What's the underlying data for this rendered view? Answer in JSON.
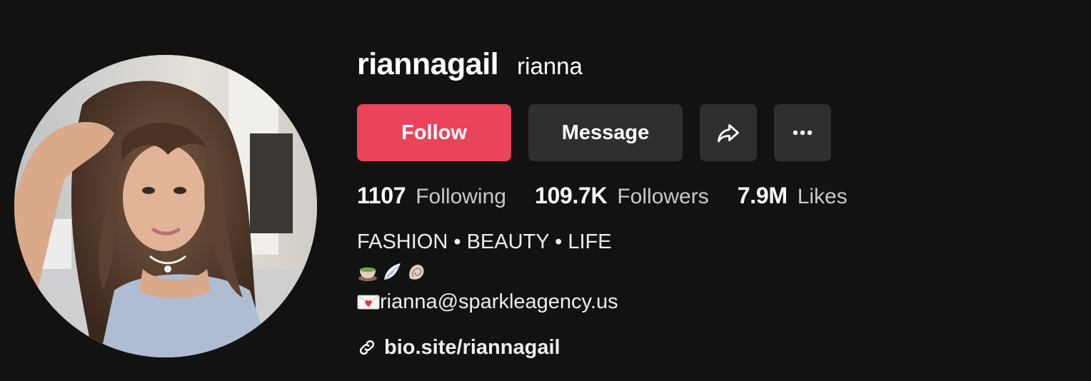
{
  "profile": {
    "username": "riannagail",
    "nickname": "rianna",
    "avatar_alt": "profile-photo"
  },
  "actions": {
    "follow_label": "Follow",
    "message_label": "Message",
    "share_icon": "share-arrow-icon",
    "more_icon": "more-dots-icon"
  },
  "stats": [
    {
      "value": "1107",
      "label": "Following"
    },
    {
      "value": "109.7K",
      "label": "Followers"
    },
    {
      "value": "7.9M",
      "label": "Likes"
    }
  ],
  "bio": {
    "line1": "FASHION • BEAUTY • LIFE",
    "emojis": [
      "matcha-bowl-emoji",
      "wing-emoji",
      "spiral-shell-emoji"
    ],
    "email": "rianna@sparkleagency.us",
    "email_icon": "love-letter-emoji"
  },
  "link": {
    "icon": "link-icon",
    "text": "bio.site/riannagail"
  },
  "colors": {
    "background": "#121212",
    "follow": "#ea435a",
    "button_secondary": "#2f2f2f",
    "text_primary": "#ffffff",
    "text_secondary": "#c9c9c9"
  }
}
